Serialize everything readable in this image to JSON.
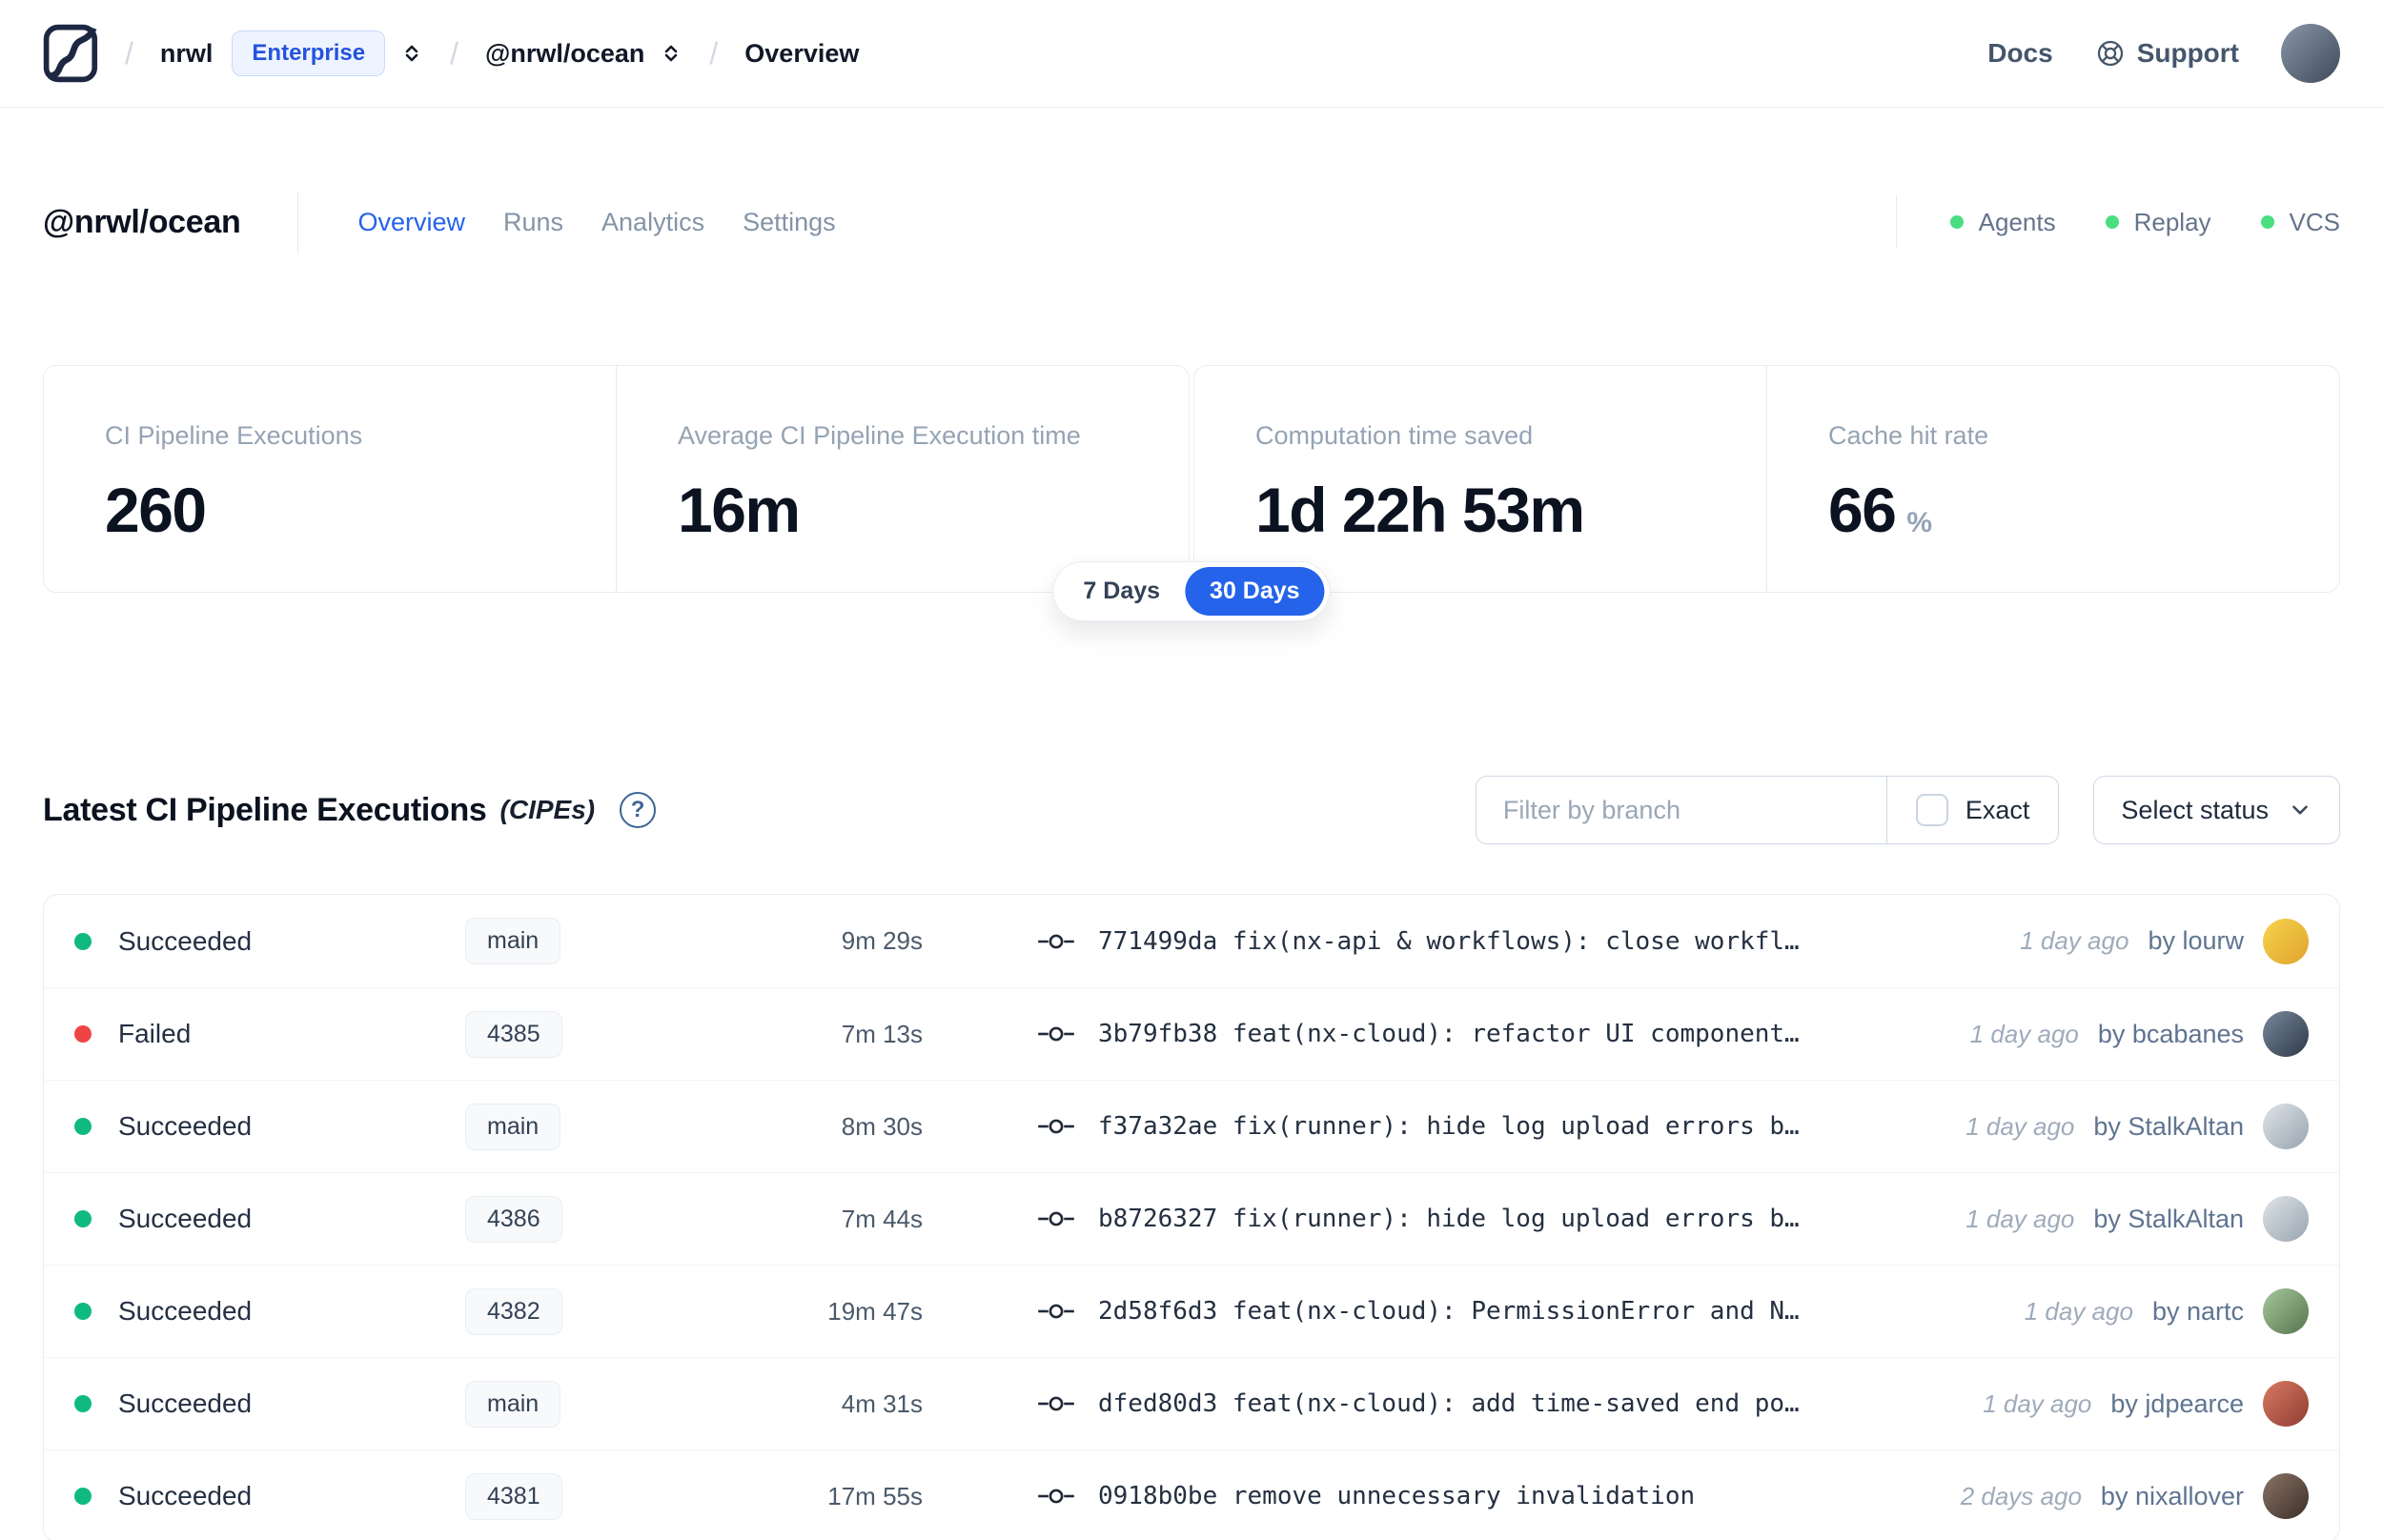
{
  "navbar": {
    "separator": "/",
    "org": "nrwl",
    "org_badge": "Enterprise",
    "workspace": "@nrwl/ocean",
    "page": "Overview",
    "docs_label": "Docs",
    "support_label": "Support",
    "avatar": [
      "#8a97a8",
      "#3e4a5a"
    ]
  },
  "workspace": {
    "title": "@nrwl/ocean",
    "tabs": [
      {
        "label": "Overview",
        "active": true
      },
      {
        "label": "Runs",
        "active": false
      },
      {
        "label": "Analytics",
        "active": false
      },
      {
        "label": "Settings",
        "active": false
      }
    ],
    "features": [
      "Agents",
      "Replay",
      "VCS"
    ]
  },
  "stats": [
    {
      "label": "CI Pipeline Executions",
      "value": "260",
      "suffix": ""
    },
    {
      "label": "Average CI Pipeline Execution time",
      "value": "16m",
      "suffix": ""
    },
    {
      "label": "Computation time saved",
      "value": "1d 22h 53m",
      "suffix": ""
    },
    {
      "label": "Cache hit rate",
      "value": "66",
      "suffix": "%"
    }
  ],
  "range_toggle": {
    "options": [
      "7 Days",
      "30 Days"
    ],
    "selected": "30 Days"
  },
  "cipe_section": {
    "title": "Latest CI Pipeline Executions",
    "subtitle": "(CIPEs)",
    "help_glyph": "?",
    "filter_placeholder": "Filter by branch",
    "filter_value": "",
    "exact_label": "Exact",
    "exact_checked": false,
    "status_select_label": "Select status"
  },
  "rows": [
    {
      "status": "Succeeded",
      "status_color": "success",
      "branch": "main",
      "duration": "9m 29s",
      "commit": "771499da fix(nx-api & workflows): close workfl…",
      "time": "1 day ago",
      "author": "by lourw",
      "avatar": [
        "#f6d44d",
        "#e0a32e"
      ]
    },
    {
      "status": "Failed",
      "status_color": "failed",
      "branch": "4385",
      "duration": "7m 13s",
      "commit": "3b79fb38 feat(nx-cloud): refactor UI component…",
      "time": "1 day ago",
      "author": "by bcabanes",
      "avatar": [
        "#77879b",
        "#2f3a47"
      ]
    },
    {
      "status": "Succeeded",
      "status_color": "success",
      "branch": "main",
      "duration": "8m 30s",
      "commit": "f37a32ae fix(runner): hide log upload errors b…",
      "time": "1 day ago",
      "author": "by StalkAltan",
      "avatar": [
        "#dfe4e8",
        "#97a4b0"
      ]
    },
    {
      "status": "Succeeded",
      "status_color": "success",
      "branch": "4386",
      "duration": "7m 44s",
      "commit": "b8726327 fix(runner): hide log upload errors b…",
      "time": "1 day ago",
      "author": "by StalkAltan",
      "avatar": [
        "#dfe4e8",
        "#97a4b0"
      ]
    },
    {
      "status": "Succeeded",
      "status_color": "success",
      "branch": "4382",
      "duration": "19m 47s",
      "commit": "2d58f6d3 feat(nx-cloud): PermissionError and N…",
      "time": "1 day ago",
      "author": "by nartc",
      "avatar": [
        "#a8c79b",
        "#55754e"
      ]
    },
    {
      "status": "Succeeded",
      "status_color": "success",
      "branch": "main",
      "duration": "4m 31s",
      "commit": "dfed80d3 feat(nx-cloud): add time-saved end po…",
      "time": "1 day ago",
      "author": "by jdpearce",
      "avatar": [
        "#d97a62",
        "#8e3d33"
      ]
    },
    {
      "status": "Succeeded",
      "status_color": "success",
      "branch": "4381",
      "duration": "17m 55s",
      "commit": "0918b0be remove unnecessary invalidation",
      "time": "2 days ago",
      "author": "by nixallover",
      "avatar": [
        "#8a7466",
        "#3c2f29"
      ]
    }
  ],
  "icons": {
    "logo": "nx-cloud-logo",
    "breadcrumb_expand": "chevron-up-down",
    "support": "lifebuoy",
    "help": "question-circle",
    "commit": "git-commit",
    "select": "chevron-down"
  },
  "colors": {
    "accent": "#2563eb",
    "success": "#10b981",
    "failed": "#ef4444",
    "feature_dot": "#4ade80"
  }
}
